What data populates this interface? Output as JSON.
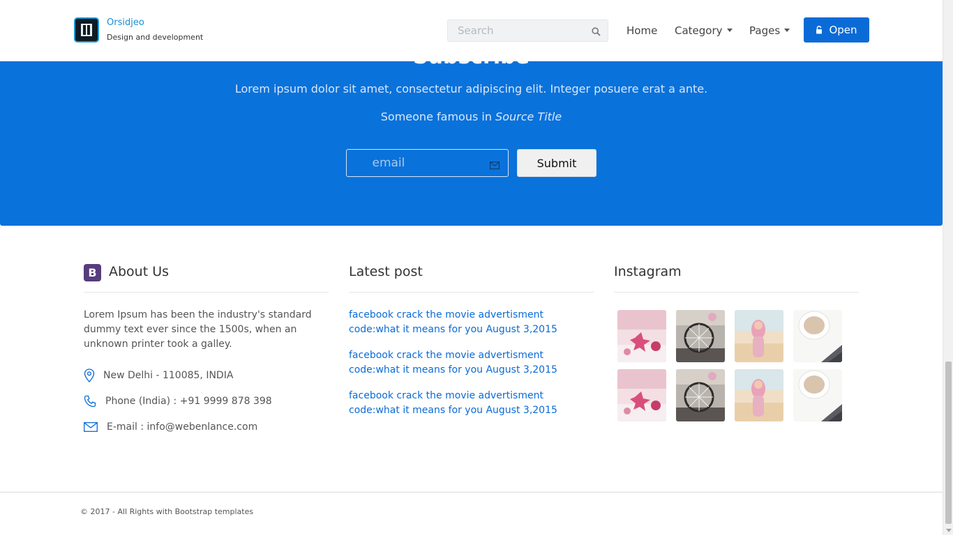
{
  "brand": {
    "name": "Orsidjeo",
    "tagline": "Design and development"
  },
  "search": {
    "placeholder": "Search"
  },
  "nav": {
    "home": "Home",
    "category": "Category",
    "pages": "Pages",
    "open_button": "Open"
  },
  "subscribe": {
    "title": "Subscribe",
    "text": "Lorem ipsum dolor sit amet, consectetur adipiscing elit. Integer posuere erat a ante.",
    "quote_prefix": "Someone famous in ",
    "quote_source": "Source Title",
    "email_placeholder": "email",
    "submit_label": "Submit"
  },
  "about": {
    "title": "About Us",
    "badge_letter": "B",
    "text": "Lorem Ipsum has been the industry's standard dummy text ever since the 1500s, when an unknown printer took a galley.",
    "address": "New Delhi - 110085, INDIA",
    "phone": "Phone (India) : +91 9999 878 398",
    "email": "E-mail : info@webenlance.com"
  },
  "latest_posts": {
    "title": "Latest post",
    "items": [
      "facebook crack the movie advertisment code:what it means for you August 3,2015",
      "facebook crack the movie advertisment code:what it means for you August 3,2015",
      "facebook crack the movie advertisment code:what it means for you August 3,2015"
    ]
  },
  "instagram": {
    "title": "Instagram",
    "photos": [
      "pink-gift-photo",
      "bicycle-wheel-photo",
      "beach-girl-photo",
      "coffee-cup-photo",
      "pink-gift-photo",
      "bicycle-wheel-photo",
      "beach-girl-photo",
      "coffee-cup-photo"
    ]
  },
  "footer": {
    "copyright": "© 2017 - All Rights with Bootstrap templates"
  },
  "colors": {
    "primary": "#0a72db",
    "button": "#0a6bd7",
    "link": "#0a6bd7",
    "bootstrap_purple": "#563d7c"
  }
}
